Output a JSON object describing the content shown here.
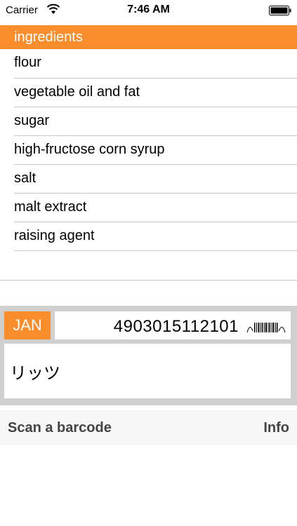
{
  "status_bar": {
    "carrier": "Carrier",
    "time": "7:46 AM",
    "icons": [
      "wifi-icon",
      "battery-icon"
    ]
  },
  "ingredients": {
    "header": "ingredients",
    "items": [
      "flour",
      "vegetable oil and fat",
      "sugar",
      "high-fructose corn syrup",
      "salt",
      "malt extract",
      "raising agent"
    ]
  },
  "scan": {
    "code_type": "JAN",
    "code_value": "4903015112101",
    "product_name": "リッツ",
    "icons": [
      "barcode-icon"
    ]
  },
  "toolbar": {
    "scan_label": "Scan a barcode",
    "info_label": "Info"
  },
  "colors": {
    "accent": "#f98d2c",
    "panel": "#cfcfcf",
    "separator": "#c8c8cc"
  }
}
